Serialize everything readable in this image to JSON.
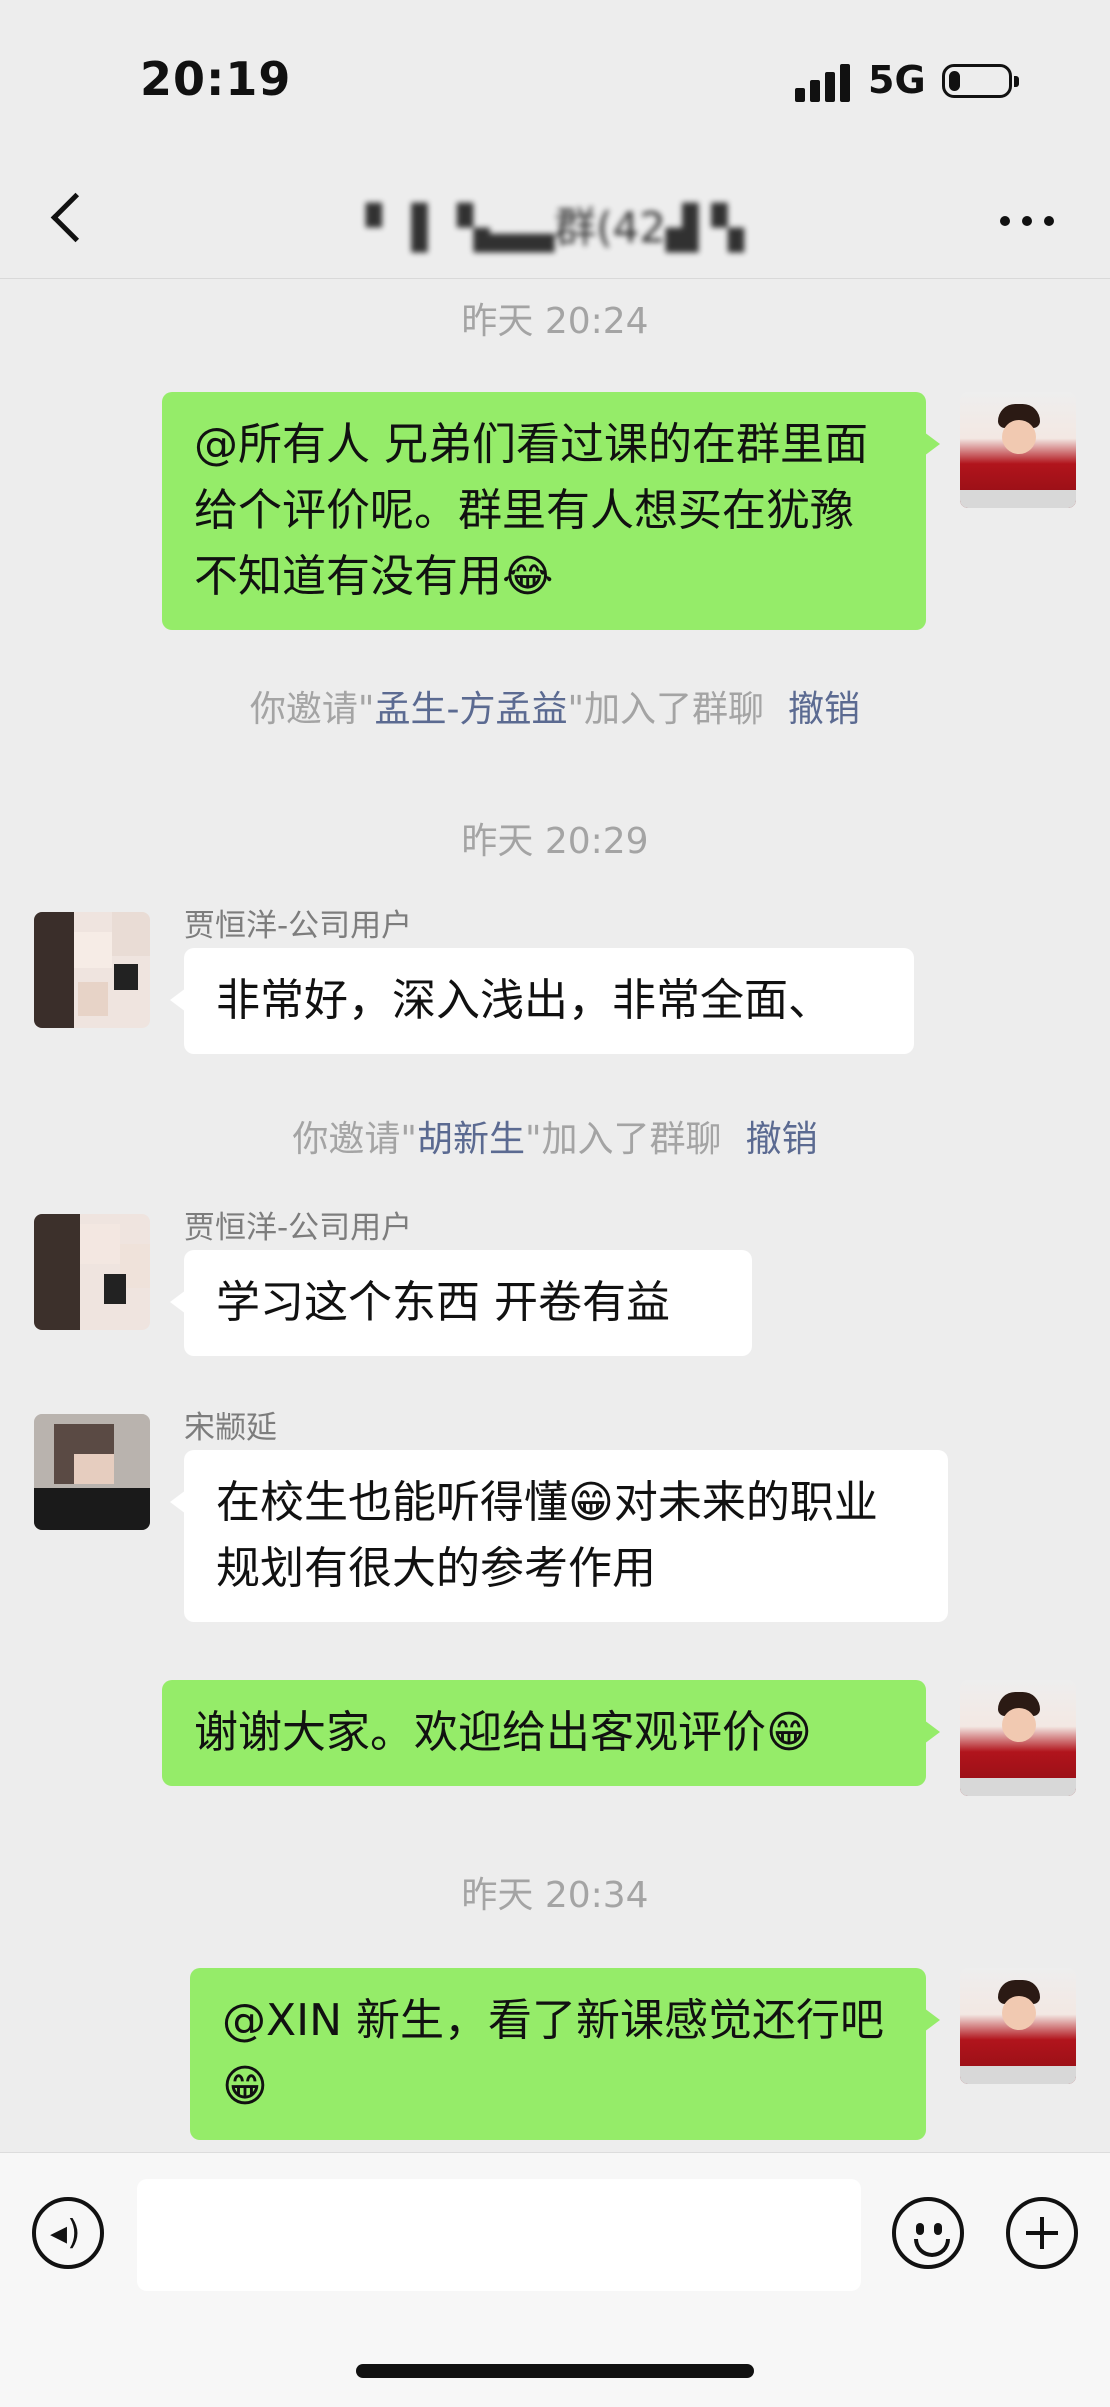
{
  "status_bar": {
    "time": "20:19",
    "network": "5G",
    "battery_level": 0.2
  },
  "nav": {
    "title": "▘ ▌ ▚▃▃群(42▟ ▚"
  },
  "messages": {
    "ts1": "昨天 20:24",
    "m1": "@所有人 兄弟们看过课的在群里面给个评价呢。群里有人想买在犹豫不知道有没有用😂",
    "sys1": {
      "prefix": "你邀请\"",
      "name": "孟生-方孟益",
      "suffix": "\"加入了群聊",
      "undo": "撤销"
    },
    "ts2": "昨天 20:29",
    "m2": {
      "sender": "贾恒洋-公司用户",
      "text": "非常好，深入浅出，非常全面、"
    },
    "sys2": {
      "prefix": "你邀请\"",
      "name": "胡新生",
      "suffix": "\"加入了群聊",
      "undo": "撤销"
    },
    "m3": {
      "sender": "贾恒洋-公司用户",
      "text": "学习这个东西 开卷有益"
    },
    "m4": {
      "sender": "宋颛延",
      "text": "在校生也能听得懂😁对未来的职业规划有很大的参考作用"
    },
    "m5": "谢谢大家。欢迎给出客观评价😁",
    "ts3": "昨天 20:34",
    "m6": "@XIN 新生，看了新课感觉还行吧😁"
  },
  "input": {
    "text": ""
  },
  "icons": [
    "back-arrow-icon",
    "more-icon",
    "voice-icon",
    "emoji-icon",
    "plus-icon"
  ]
}
